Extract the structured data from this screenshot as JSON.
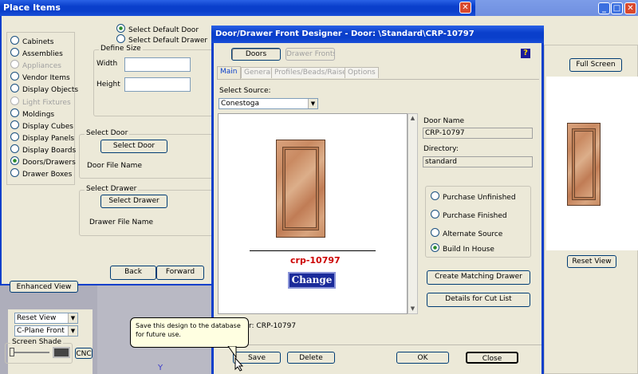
{
  "colors": {
    "title_blue": "#0a3fcb",
    "dialog_bg": "#ece9d8",
    "accent_red": "#cc0000",
    "change_btn": "#1a2a9a"
  },
  "place_items": {
    "title": "Place Items",
    "categories": [
      {
        "label": "Cabinets",
        "enabled": true,
        "selected": false
      },
      {
        "label": "Assemblies",
        "enabled": true,
        "selected": false
      },
      {
        "label": "Appliances",
        "enabled": false,
        "selected": false
      },
      {
        "label": "Vendor Items",
        "enabled": true,
        "selected": false
      },
      {
        "label": "Display Objects",
        "enabled": true,
        "selected": false
      },
      {
        "label": "Light Fixtures",
        "enabled": false,
        "selected": false
      },
      {
        "label": "Moldings",
        "enabled": true,
        "selected": false
      },
      {
        "label": "Display Cubes",
        "enabled": true,
        "selected": false
      },
      {
        "label": "Display Panels",
        "enabled": true,
        "selected": false
      },
      {
        "label": "Display Boards",
        "enabled": true,
        "selected": false
      },
      {
        "label": "Doors/Drawers",
        "enabled": true,
        "selected": true
      },
      {
        "label": "Drawer Boxes",
        "enabled": true,
        "selected": false
      }
    ],
    "select_default_door": "Select Default Door",
    "select_default_drawer": "Select Default Drawer",
    "define_size": "Define Size",
    "width_label": "Width",
    "height_label": "Height",
    "select_door_group": "Select Door",
    "select_door_btn": "Select Door",
    "door_file_name": "Door File Name",
    "select_drawer_group": "Select Drawer",
    "select_drawer_btn": "Select Drawer",
    "drawer_file_name": "Drawer File Name",
    "back": "Back",
    "forward": "Forward"
  },
  "left_panel": {
    "enhanced_view": "Enhanced View",
    "reset_view": "Reset View",
    "cplane_front": "C-Plane Front",
    "screen_shade": "Screen Shade",
    "cnc": "CNC"
  },
  "designer": {
    "title": "Door/Drawer Front Designer - Door: \\Standard\\CRP-10797",
    "help_icon": "?",
    "doors_btn": "Doors",
    "drawer_fronts_btn": "Drawer Fronts",
    "tabs": [
      {
        "label": "Main",
        "active": true,
        "enabled": true
      },
      {
        "label": "General",
        "active": false,
        "enabled": false
      },
      {
        "label": "Profiles/Beads/Raises",
        "active": false,
        "enabled": false
      },
      {
        "label": "Options",
        "active": false,
        "enabled": false
      }
    ],
    "select_source_label": "Select Source:",
    "select_source_value": "Conestoga",
    "door_code": "crp-10797",
    "change_btn": "Change",
    "door_name_label": "Door Name",
    "door_name_value": "CRP-10797",
    "directory_label": "Directory:",
    "directory_value": "standard",
    "source_options": [
      {
        "label": "Purchase Unfinished",
        "selected": false
      },
      {
        "label": "Purchase Finished",
        "selected": false
      },
      {
        "label": "Alternate Source",
        "selected": false
      },
      {
        "label": "Build In House",
        "selected": true
      }
    ],
    "create_matching_drawer": "Create Matching Drawer",
    "details_for_cut_list": "Details for Cut List",
    "door_text_partial": "r: CRP-10797",
    "save": "Save",
    "delete": "Delete",
    "ok": "OK",
    "close": "Close"
  },
  "right_panel": {
    "full_screen": "Full Screen",
    "reset_view": "Reset View"
  },
  "tooltip": {
    "text": "Save this design to the database for future use."
  },
  "y_axis_label": "Y"
}
